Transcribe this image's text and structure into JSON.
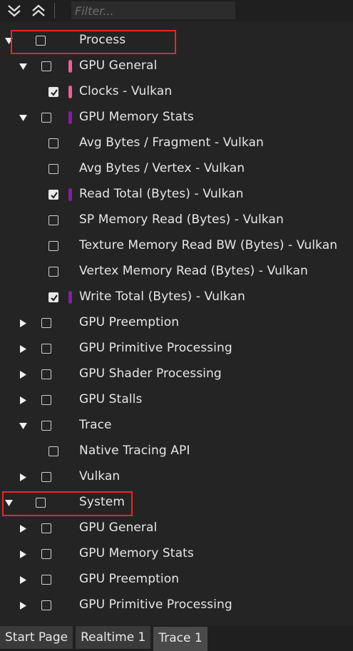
{
  "toolbar": {
    "expand_all_icon": "double-chevron-down-icon",
    "collapse_all_icon": "double-chevron-up-icon",
    "filter_placeholder": "Filter..."
  },
  "tree": [
    {
      "label": "Process",
      "level": 0,
      "arrow": "down",
      "checked": false,
      "swatch": null,
      "highlight": true
    },
    {
      "label": "GPU General",
      "level": 1,
      "arrow": "down",
      "checked": false,
      "swatch": "#f25c9a",
      "highlight": false
    },
    {
      "label": "Clocks - Vulkan",
      "level": 2,
      "arrow": null,
      "checked": true,
      "swatch": "#f25c9a",
      "highlight": false
    },
    {
      "label": "GPU Memory Stats",
      "level": 1,
      "arrow": "down",
      "checked": false,
      "swatch": "#8a1aa8",
      "highlight": false
    },
    {
      "label": "Avg Bytes / Fragment - Vulkan",
      "level": 2,
      "arrow": null,
      "checked": false,
      "swatch": null,
      "highlight": false
    },
    {
      "label": "Avg Bytes / Vertex - Vulkan",
      "level": 2,
      "arrow": null,
      "checked": false,
      "swatch": null,
      "highlight": false
    },
    {
      "label": "Read Total (Bytes) - Vulkan",
      "level": 2,
      "arrow": null,
      "checked": true,
      "swatch": "#8a1aa8",
      "highlight": false
    },
    {
      "label": "SP Memory Read (Bytes) - Vulkan",
      "level": 2,
      "arrow": null,
      "checked": false,
      "swatch": null,
      "highlight": false
    },
    {
      "label": "Texture Memory Read BW (Bytes) - Vulkan",
      "level": 2,
      "arrow": null,
      "checked": false,
      "swatch": null,
      "highlight": false
    },
    {
      "label": "Vertex Memory Read (Bytes) - Vulkan",
      "level": 2,
      "arrow": null,
      "checked": false,
      "swatch": null,
      "highlight": false
    },
    {
      "label": "Write Total (Bytes) - Vulkan",
      "level": 2,
      "arrow": null,
      "checked": true,
      "swatch": "#8a1aa8",
      "highlight": false
    },
    {
      "label": "GPU Preemption",
      "level": 1,
      "arrow": "right",
      "checked": false,
      "swatch": null,
      "highlight": false
    },
    {
      "label": "GPU Primitive Processing",
      "level": 1,
      "arrow": "right",
      "checked": false,
      "swatch": null,
      "highlight": false
    },
    {
      "label": "GPU Shader Processing",
      "level": 1,
      "arrow": "right",
      "checked": false,
      "swatch": null,
      "highlight": false
    },
    {
      "label": "GPU Stalls",
      "level": 1,
      "arrow": "right",
      "checked": false,
      "swatch": null,
      "highlight": false
    },
    {
      "label": "Trace",
      "level": 1,
      "arrow": "down",
      "checked": false,
      "swatch": null,
      "highlight": false
    },
    {
      "label": "Native Tracing API",
      "level": 2,
      "arrow": null,
      "checked": false,
      "swatch": null,
      "highlight": false
    },
    {
      "label": "Vulkan",
      "level": 1,
      "arrow": "right",
      "checked": false,
      "swatch": null,
      "highlight": false
    },
    {
      "label": "System",
      "level": 0,
      "arrow": "down",
      "checked": false,
      "swatch": null,
      "highlight": true
    },
    {
      "label": "GPU General",
      "level": 1,
      "arrow": "right",
      "checked": false,
      "swatch": null,
      "highlight": false
    },
    {
      "label": "GPU Memory Stats",
      "level": 1,
      "arrow": "right",
      "checked": false,
      "swatch": null,
      "highlight": false
    },
    {
      "label": "GPU Preemption",
      "level": 1,
      "arrow": "right",
      "checked": false,
      "swatch": null,
      "highlight": false
    },
    {
      "label": "GPU Primitive Processing",
      "level": 1,
      "arrow": "right",
      "checked": false,
      "swatch": null,
      "highlight": false
    }
  ],
  "tabs": [
    {
      "label": "Start Page",
      "active": false
    },
    {
      "label": "Realtime 1",
      "active": false
    },
    {
      "label": "Trace 1",
      "active": true
    }
  ],
  "colors": {
    "highlight_box": "#e8262a",
    "gpu_general_swatch": "#f25c9a",
    "gpu_memory_swatch": "#8a1aa8"
  }
}
